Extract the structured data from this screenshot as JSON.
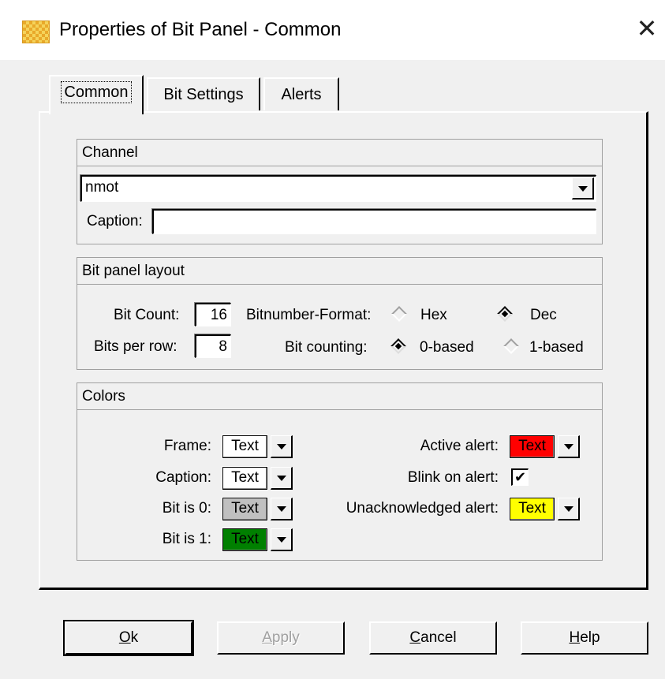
{
  "window": {
    "title": "Properties of Bit Panel - Common",
    "icon": "app-icon",
    "close_glyph": "✕"
  },
  "tabs": [
    {
      "label": "Common",
      "active": true
    },
    {
      "label": "Bit Settings",
      "active": false
    },
    {
      "label": "Alerts",
      "active": false
    }
  ],
  "channel": {
    "header": "Channel",
    "selected": "nmot",
    "caption_label": "Caption:",
    "caption_value": ""
  },
  "layout": {
    "header": "Bit panel layout",
    "bit_count_label": "Bit Count:",
    "bit_count_value": "16",
    "bits_per_row_label": "Bits per row:",
    "bits_per_row_value": "8",
    "format_label": "Bitnumber-Format:",
    "format_options": [
      "Hex",
      "Dec"
    ],
    "format_selected": "Dec",
    "counting_label": "Bit counting:",
    "counting_options": [
      "0-based",
      "1-based"
    ],
    "counting_selected": "0-based"
  },
  "colors": {
    "header": "Colors",
    "swatch_text": "Text",
    "frame_label": "Frame:",
    "caption_label": "Caption:",
    "bit0_label": "Bit is 0:",
    "bit1_label": "Bit is 1:",
    "active_alert_label": "Active alert:",
    "blink_label": "Blink on alert:",
    "blink_checked": true,
    "unack_label": "Unacknowledged alert:",
    "frame_color": "#ffffff",
    "caption_color": "#ffffff",
    "bit0_color": "#c0c0c0",
    "bit1_color": "#008000",
    "active_alert_color": "#ff0000",
    "unack_color": "#ffff00"
  },
  "buttons": {
    "ok": "Ok",
    "apply": "Apply",
    "cancel": "Cancel",
    "help": "Help"
  }
}
